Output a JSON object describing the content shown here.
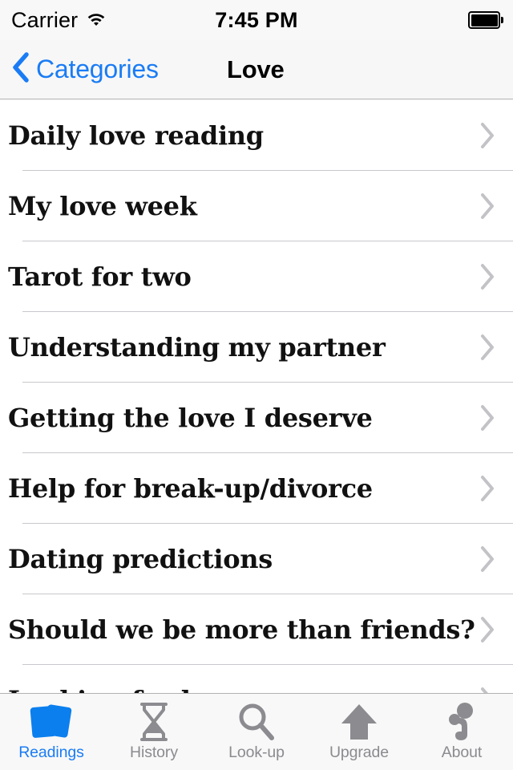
{
  "status_bar": {
    "carrier": "Carrier",
    "wifi_icon": "wifi-icon",
    "time": "7:45 PM",
    "battery_icon": "battery-full-icon"
  },
  "nav_bar": {
    "back_icon": "chevron-left-icon",
    "back_label": "Categories",
    "title": "Love"
  },
  "list": {
    "disclosure_icon": "chevron-right-icon",
    "rows": [
      {
        "label": "Daily love reading"
      },
      {
        "label": "My love week"
      },
      {
        "label": "Tarot for two"
      },
      {
        "label": "Understanding my partner"
      },
      {
        "label": "Getting the love I deserve"
      },
      {
        "label": "Help for break-up/divorce"
      },
      {
        "label": "Dating predictions"
      },
      {
        "label": "Should we be more than friends?"
      },
      {
        "label": "Looking for love"
      }
    ]
  },
  "tab_bar": {
    "tabs": [
      {
        "label": "Readings",
        "icon": "cards-icon",
        "active": true
      },
      {
        "label": "History",
        "icon": "hourglass-icon",
        "active": false
      },
      {
        "label": "Look-up",
        "icon": "magnifier-icon",
        "active": false
      },
      {
        "label": "Upgrade",
        "icon": "arrow-up-icon",
        "active": false
      },
      {
        "label": "About",
        "icon": "info-person-icon",
        "active": false
      }
    ]
  },
  "colors": {
    "accent_blue": "#0b7fee",
    "tab_inactive_gray": "#8b8b90",
    "separator_gray": "#c8c7cc",
    "bar_background": "#f7f7f7"
  }
}
